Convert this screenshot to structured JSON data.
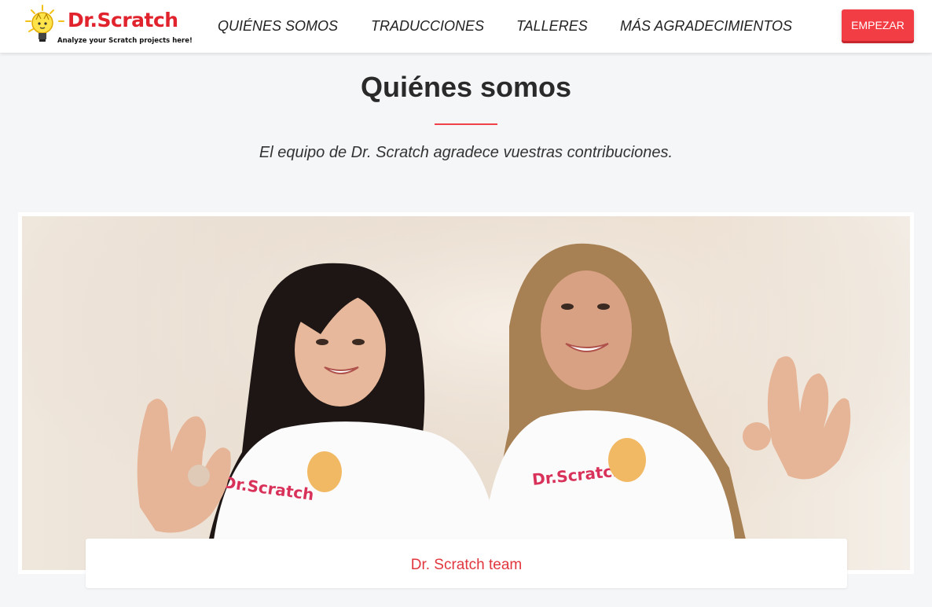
{
  "brand": {
    "name": "Dr.Scratch",
    "tagline": "Analyze your Scratch projects here!",
    "icon": "lightbulb-cat-icon",
    "color": "#e1232e"
  },
  "nav": {
    "links": [
      {
        "label": "QUIÉNES SOMOS"
      },
      {
        "label": "TRADUCCIONES"
      },
      {
        "label": "TALLERES"
      },
      {
        "label": "MÁS AGRADECIMIENTOS"
      }
    ],
    "cta_label": "EMPEZAR"
  },
  "main": {
    "title": "Quiénes somos",
    "subtitle": "El equipo de Dr. Scratch agradece vuestras contribuciones.",
    "caption": "Dr. Scratch team"
  },
  "colors": {
    "accent": "#f33d45",
    "caption_text": "#e2363e",
    "page_background": "#f5f6f8"
  }
}
